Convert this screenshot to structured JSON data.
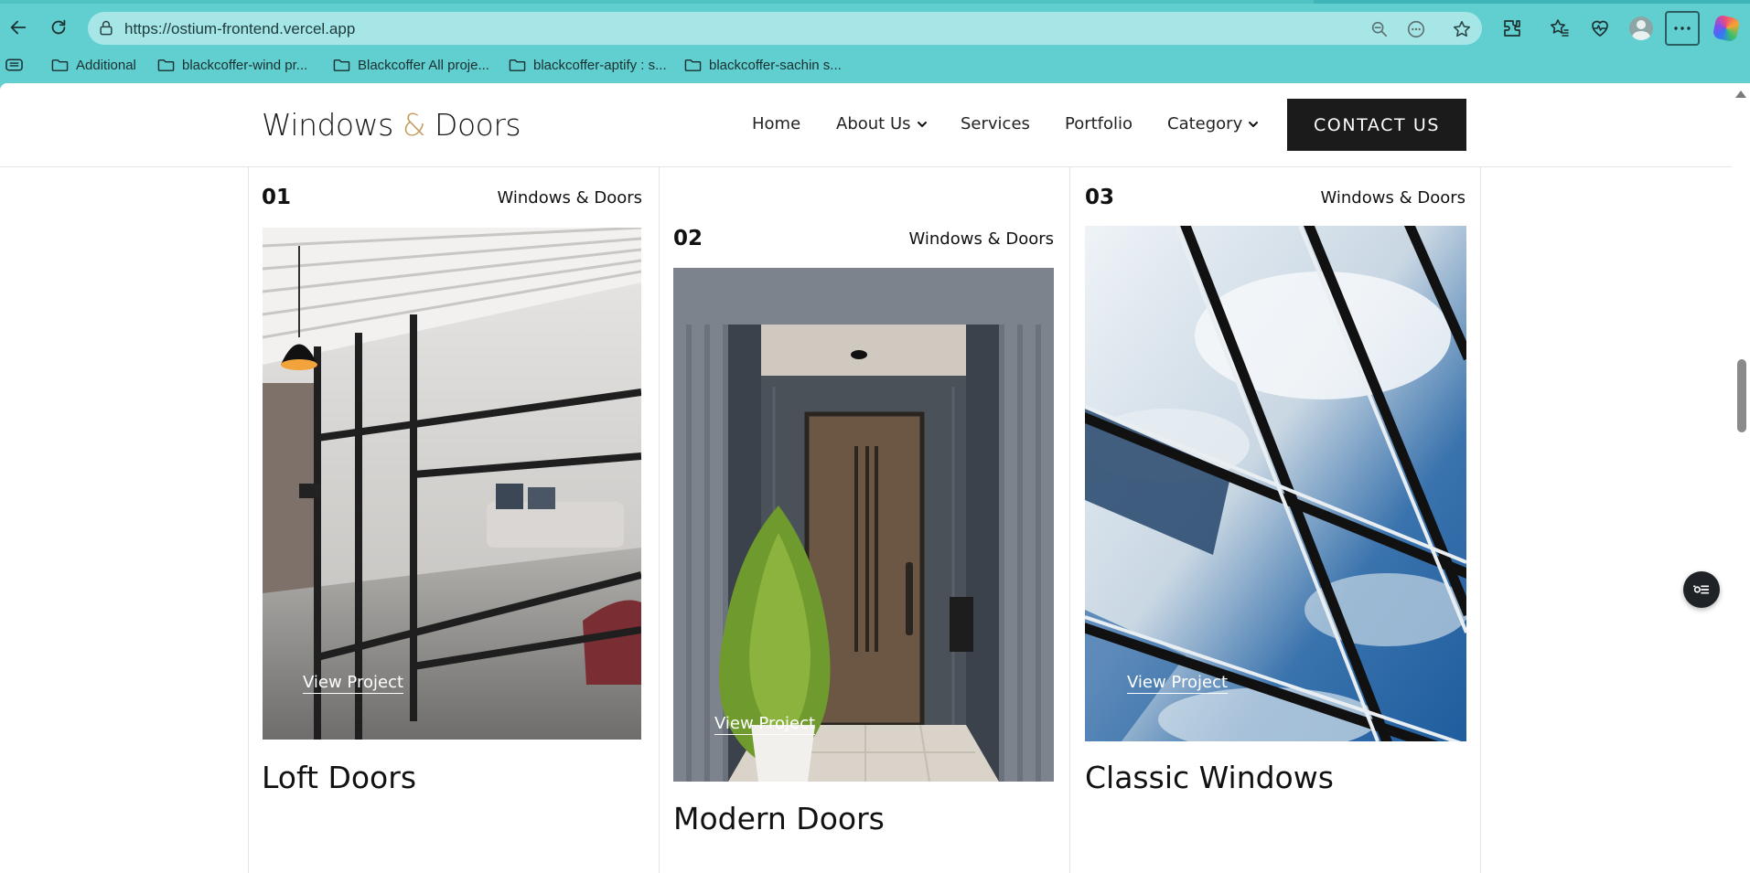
{
  "browser": {
    "url": "https://ostium-frontend.vercel.app",
    "bookmarks": [
      "Additional",
      "blackcoffer-wind pr...",
      "Blackcoffer All proje...",
      "blackcoffer-aptify : s...",
      "blackcoffer-sachin s..."
    ]
  },
  "site": {
    "logo_left": "Windows ",
    "logo_amp": "&",
    "logo_right": " Doors",
    "nav": [
      "Home",
      "About Us",
      "Services",
      "Portfolio",
      "Category"
    ],
    "contact_label": "CONTACT US"
  },
  "cards": [
    {
      "number": "01",
      "category": "Windows & Doors",
      "link": "View Project",
      "title": "Loft Doors"
    },
    {
      "number": "02",
      "category": "Windows & Doors",
      "link": "View Project",
      "title": "Modern Doors"
    },
    {
      "number": "03",
      "category": "Windows & Doors",
      "link": "View Project",
      "title": "Classic Windows"
    }
  ],
  "colors": {
    "browser_frame": "#61cfd0",
    "address_bar": "#a7e6e6",
    "accent_amp": "#c49a5a",
    "contact_bg": "#1b1b1b"
  },
  "icons": [
    "back-arrow-icon",
    "reload-icon",
    "lock-icon",
    "zoom-out-icon",
    "read-aloud-icon",
    "favorite-star-icon",
    "extensions-icon",
    "favorites-icon",
    "health-icon",
    "profile-icon",
    "more-icon",
    "copilot-icon",
    "folder-icon",
    "chevron-down-icon",
    "filter-settings-icon"
  ]
}
